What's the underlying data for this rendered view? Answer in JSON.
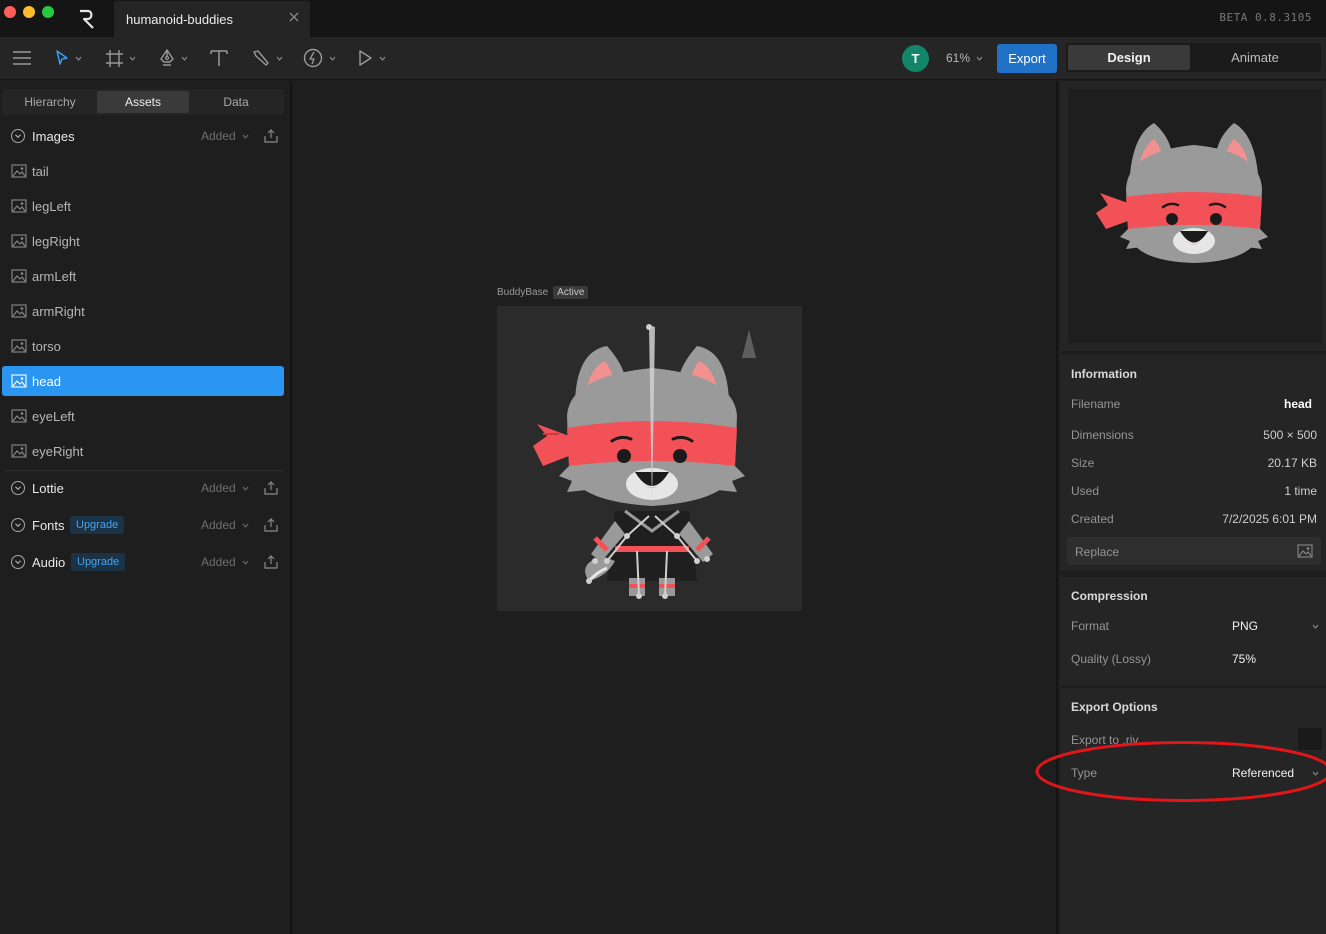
{
  "app": {
    "version": "BETA 0.8.3105",
    "document_tab": "humanoid-buddies"
  },
  "toolbar": {
    "avatar_initial": "T",
    "zoom": "61%",
    "export_label": "Export",
    "mode_design": "Design",
    "mode_animate": "Animate",
    "tools": [
      "menu-icon",
      "select-tool-icon",
      "frame-tool-icon",
      "pen-tool-icon",
      "text-tool-icon",
      "bone-tool-icon",
      "constraint-tool-icon",
      "play-icon"
    ]
  },
  "left_panel": {
    "tabs": [
      {
        "label": "Hierarchy",
        "active": false
      },
      {
        "label": "Assets",
        "active": true
      },
      {
        "label": "Data",
        "active": false
      }
    ],
    "images_section": {
      "title": "Images",
      "filter": "Added"
    },
    "assets": [
      {
        "label": "tail",
        "selected": false
      },
      {
        "label": "legLeft",
        "selected": false
      },
      {
        "label": "legRight",
        "selected": false
      },
      {
        "label": "armLeft",
        "selected": false
      },
      {
        "label": "armRight",
        "selected": false
      },
      {
        "label": "torso",
        "selected": false
      },
      {
        "label": "head",
        "selected": true
      },
      {
        "label": "eyeLeft",
        "selected": false
      },
      {
        "label": "eyeRight",
        "selected": false
      }
    ],
    "lottie_section": {
      "title": "Lottie",
      "filter": "Added"
    },
    "fonts_section": {
      "title": "Fonts",
      "badge": "Upgrade",
      "filter": "Added"
    },
    "audio_section": {
      "title": "Audio",
      "badge": "Upgrade",
      "filter": "Added"
    }
  },
  "canvas": {
    "artboard_name": "BuddyBase",
    "artboard_status": "Active"
  },
  "right_panel": {
    "information": {
      "title": "Information",
      "filename_label": "Filename",
      "filename_value": "head",
      "dimensions_label": "Dimensions",
      "dimensions_value": "500 × 500",
      "size_label": "Size",
      "size_value": "20.17 KB",
      "used_label": "Used",
      "used_value": "1 time",
      "created_label": "Created",
      "created_value": "7/2/2025 6:01 PM",
      "replace_label": "Replace"
    },
    "compression": {
      "title": "Compression",
      "format_label": "Format",
      "format_value": "PNG",
      "quality_label": "Quality (Lossy)",
      "quality_value": "75%"
    },
    "export_options": {
      "title": "Export Options",
      "export_to_label": "Export to .riv",
      "type_label": "Type",
      "type_value": "Referenced"
    }
  },
  "colors": {
    "accent": "#2a96f2",
    "export_button": "#1f72c6",
    "annotation": "#e0161b",
    "character_band": "#f25257",
    "character_fur": "#9a9a9a"
  }
}
